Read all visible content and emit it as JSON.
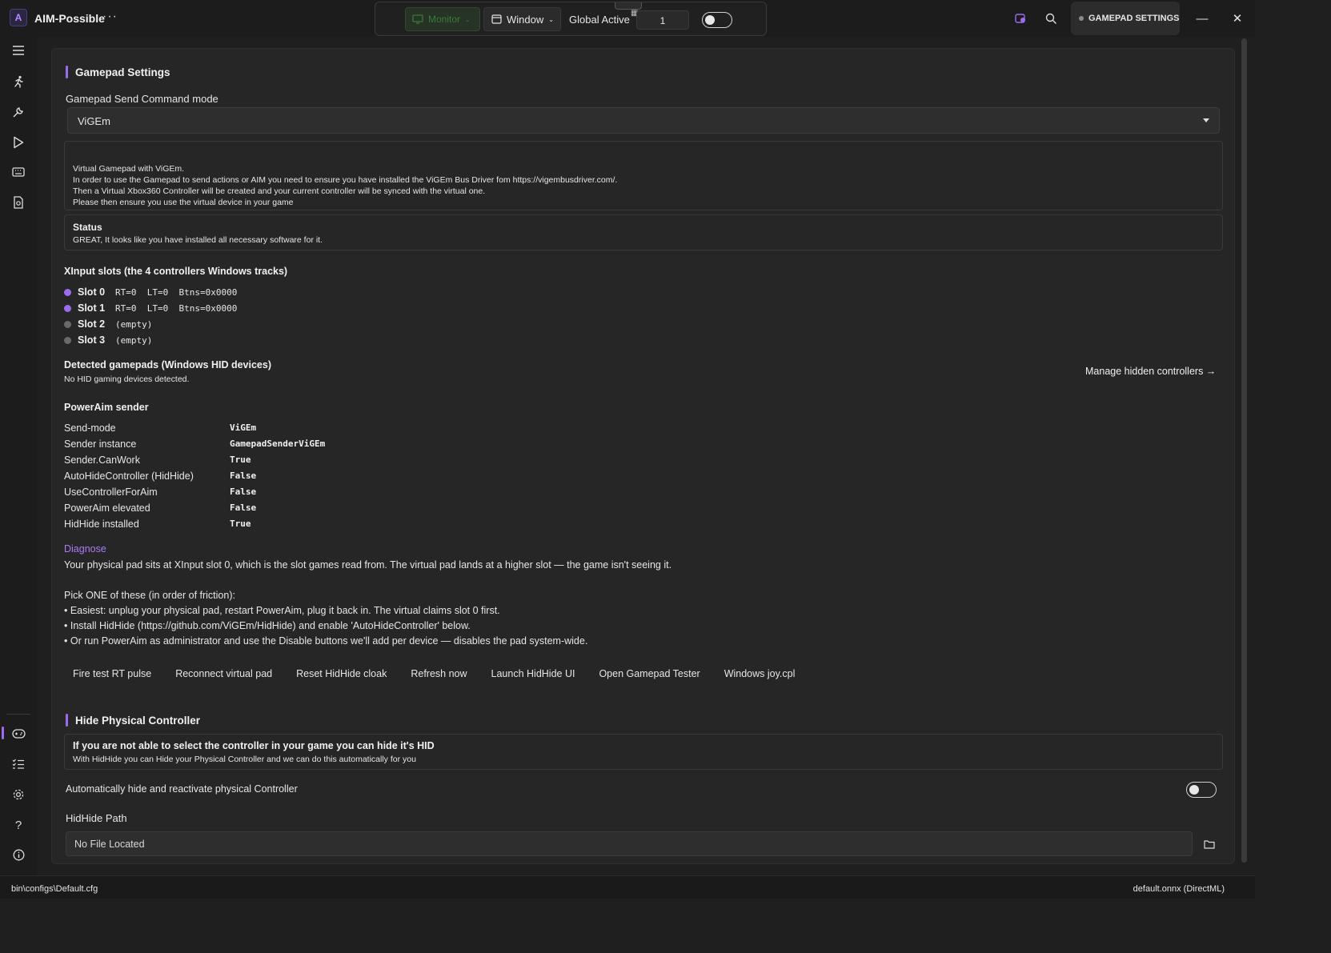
{
  "window": {
    "title": "AIM-Possible",
    "more_label": "···",
    "minimize_label": "—",
    "close_label": "✕"
  },
  "toolbar": {
    "monitor_label": "Monitor",
    "window_label": "Window",
    "global_active_label": "Global Active",
    "global_active_value": "1",
    "global_active_on": false
  },
  "header_right": {
    "gamepad_settings_label": "GAMEPAD SETTINGS"
  },
  "rail": {
    "icons": [
      "menu-icon",
      "run-icon",
      "wrench-icon",
      "play-icon",
      "keyboard-icon",
      "file-icon",
      "gamepad-icon",
      "checklist-icon",
      "gear-icon",
      "help-icon",
      "info-icon"
    ],
    "active": "gamepad-icon"
  },
  "gamepad": {
    "section_title": "Gamepad Settings",
    "mode_label": "Gamepad Send Command mode",
    "mode_value": "ViGEm",
    "info_lines": [
      "Virtual Gamepad with ViGEm.",
      "In order to use the Gamepad to send actions or AIM you need to ensure you have installed the ViGEm Bus Driver fom https://vigembusdriver.com/.",
      "Then a Virtual Xbox360 Controller will be created and your current controller will be synced with the virtual one.",
      "Please then ensure you use the virtual device in your game"
    ],
    "status_title": "Status",
    "status_text": "GREAT, It looks like you have installed all necessary software for it."
  },
  "xinput": {
    "title": "XInput slots (the 4 controllers Windows tracks)",
    "slots": [
      {
        "name": "Slot 0",
        "info": "RT=0  LT=0  Btns=0x0000",
        "active": true
      },
      {
        "name": "Slot 1",
        "info": "RT=0  LT=0  Btns=0x0000",
        "active": true
      },
      {
        "name": "Slot 2",
        "info": "(empty)",
        "active": false
      },
      {
        "name": "Slot 3",
        "info": "(empty)",
        "active": false
      }
    ]
  },
  "hid": {
    "title": "Detected gamepads (Windows HID devices)",
    "empty_text": "No HID gaming devices detected.",
    "manage_link": "Manage hidden controllers →"
  },
  "sender": {
    "title": "PowerAim sender",
    "rows": [
      {
        "key": "Send-mode",
        "value": "ViGEm"
      },
      {
        "key": "Sender instance",
        "value": "GamepadSenderViGEm"
      },
      {
        "key": "Sender.CanWork",
        "value": "True"
      },
      {
        "key": "AutoHideController (HidHide)",
        "value": "False"
      },
      {
        "key": "UseControllerForAim",
        "value": "False"
      },
      {
        "key": "PowerAim elevated",
        "value": "False"
      },
      {
        "key": "HidHide installed",
        "value": "True"
      }
    ]
  },
  "diagnose": {
    "title": "Diagnose",
    "summary": "Your physical pad sits at XInput slot 0, which is the slot games read from. The virtual pad lands at a higher slot — the game isn't seeing it.",
    "pick_title": "Pick ONE of these (in order of friction):",
    "options": [
      "• Easiest: unplug your physical pad, restart PowerAim, plug it back in. The virtual claims slot 0 first.",
      "• Install HidHide (https://github.com/ViGEm/HidHide) and enable 'AutoHideController' below.",
      "• Or run PowerAim as administrator and use the Disable buttons we'll add per device — disables the pad system-wide."
    ]
  },
  "actions": [
    "Fire test RT pulse",
    "Reconnect virtual pad",
    "Reset HidHide cloak",
    "Refresh now",
    "Launch HidHide UI",
    "Open Gamepad Tester",
    "Windows joy.cpl"
  ],
  "hide_physical": {
    "section_title": "Hide Physical Controller",
    "box_title": "If you are not able to select the controller in your game you can hide it's HID",
    "box_text": "With HidHide you can Hide your Physical Controller and we can do this automatically for you",
    "auto_label": "Automatically hide and reactivate physical Controller",
    "auto_on": false,
    "path_label": "HidHide Path",
    "path_value": "No File Located"
  },
  "statusbar": {
    "config_path": "bin\\configs\\Default.cfg",
    "model": "default.onnx (DirectML)"
  },
  "colors": {
    "accent": "#9b6cf0",
    "slot_active": "#9b6cf0",
    "slot_inactive": "#6a6a6a",
    "monitor_green": "#3a7a3a"
  }
}
